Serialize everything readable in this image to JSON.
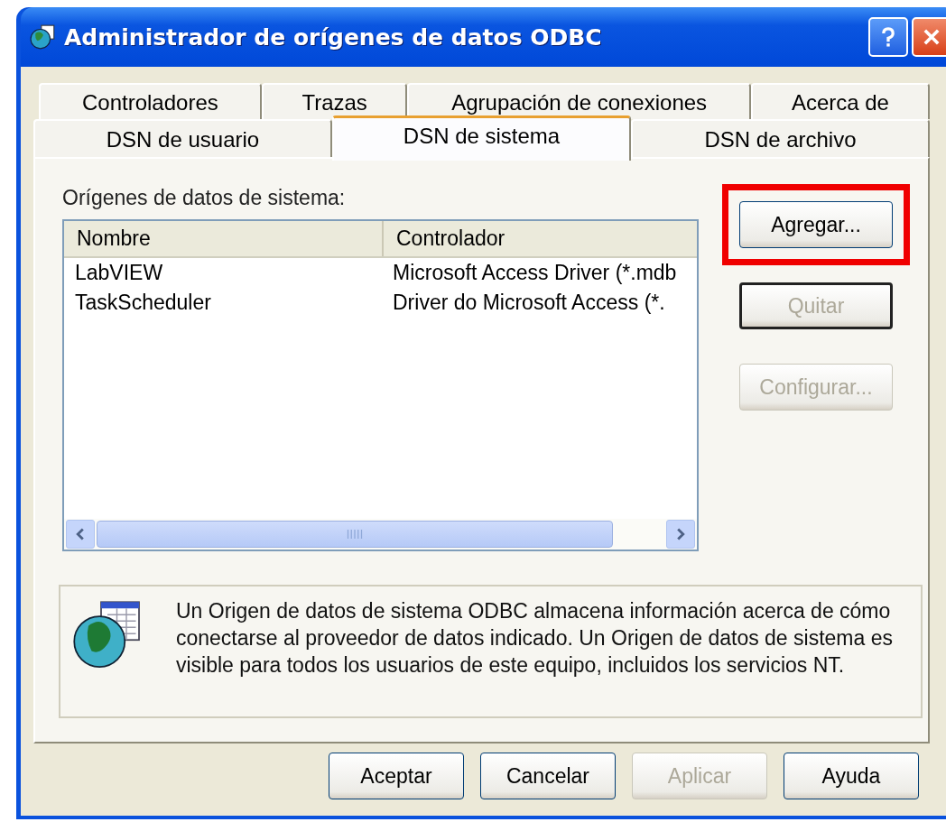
{
  "window": {
    "title": "Administrador de orígenes de datos ODBC"
  },
  "tab_rows": [
    [
      {
        "label": "Controladores",
        "selected": false
      },
      {
        "label": "Trazas",
        "selected": false
      },
      {
        "label": "Agrupación de conexiones",
        "selected": false
      },
      {
        "label": "Acerca de",
        "selected": false
      }
    ],
    [
      {
        "label": "DSN de usuario",
        "selected": false
      },
      {
        "label": "DSN de sistema",
        "selected": true
      },
      {
        "label": "DSN de archivo",
        "selected": false
      }
    ]
  ],
  "list": {
    "label": "Orígenes de datos de sistema:",
    "columns": [
      "Nombre",
      "Controlador"
    ],
    "rows": [
      [
        "LabVIEW",
        "Microsoft Access Driver (*.mdb"
      ],
      [
        "TaskScheduler",
        "Driver do Microsoft Access (*."
      ]
    ]
  },
  "side_buttons": [
    {
      "label": "Agregar...",
      "disabled": false,
      "default": false,
      "highlighted": true
    },
    {
      "label": "Quitar",
      "disabled": true,
      "default": true,
      "highlighted": false
    },
    {
      "label": "Configurar...",
      "disabled": true,
      "default": false,
      "highlighted": false
    }
  ],
  "info": "Un Origen de datos de sistema ODBC almacena información acerca de cómo conectarse al proveedor de datos indicado. Un Origen de datos de sistema es visible para todos los usuarios de este equipo, incluidos los servicios NT.",
  "buttons": [
    {
      "label": "Aceptar",
      "disabled": false
    },
    {
      "label": "Cancelar",
      "disabled": false
    },
    {
      "label": "Aplicar",
      "disabled": true
    },
    {
      "label": "Ayuda",
      "disabled": false
    }
  ]
}
